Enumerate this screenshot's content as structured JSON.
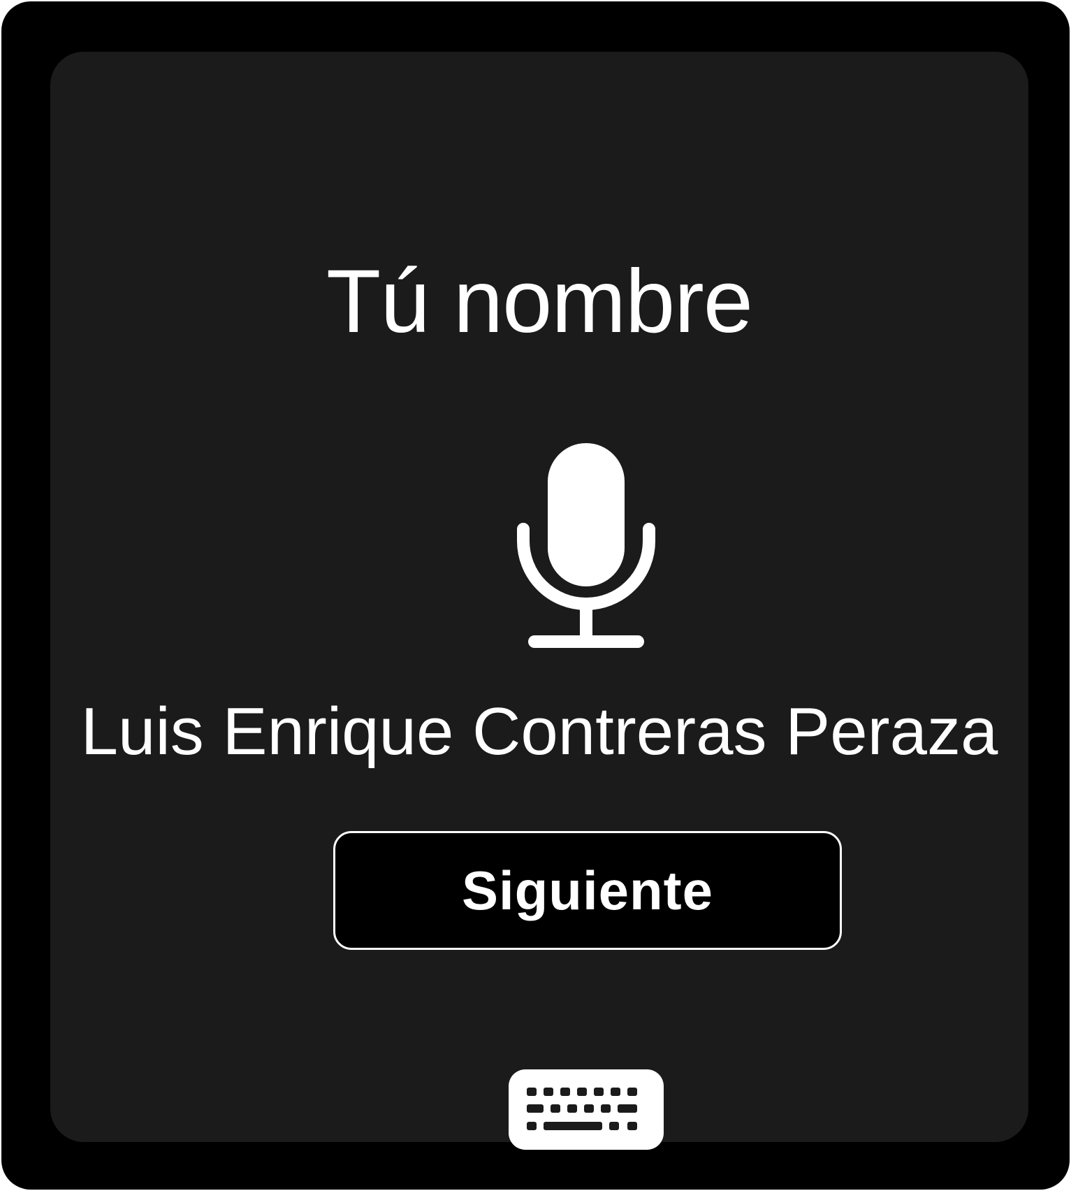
{
  "prompt": {
    "title": "Tú nombre"
  },
  "voice": {
    "icon": "microphone-icon",
    "recognized_text": "Luis Enrique Contreras Peraza"
  },
  "actions": {
    "next_label": "Siguiente",
    "keyboard_icon": "keyboard-icon"
  },
  "colors": {
    "frame": "#000000",
    "panel": "#1b1b1b",
    "foreground": "#ffffff",
    "button_fill": "#000000"
  }
}
